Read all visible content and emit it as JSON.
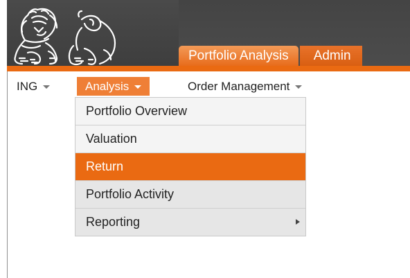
{
  "header": {
    "tabs": [
      {
        "label": "Portfolio Analysis",
        "active": true
      },
      {
        "label": "Admin",
        "active": false
      }
    ],
    "colors": {
      "banner": "#444444",
      "accent": "#ea6a12"
    }
  },
  "menubar": {
    "items": [
      {
        "label": "ING",
        "has_caret": true
      },
      {
        "label": "Analysis",
        "has_caret": true,
        "open": true
      },
      {
        "label": "Order Management",
        "has_caret": true
      }
    ]
  },
  "dropdown": {
    "items": [
      {
        "label": "Portfolio Overview"
      },
      {
        "label": "Valuation"
      },
      {
        "label": "Return",
        "highlighted": true
      },
      {
        "label": "Portfolio Activity"
      },
      {
        "label": "Reporting",
        "submenu": true
      }
    ]
  },
  "logo": {
    "icon": "ing-lion-logo"
  }
}
